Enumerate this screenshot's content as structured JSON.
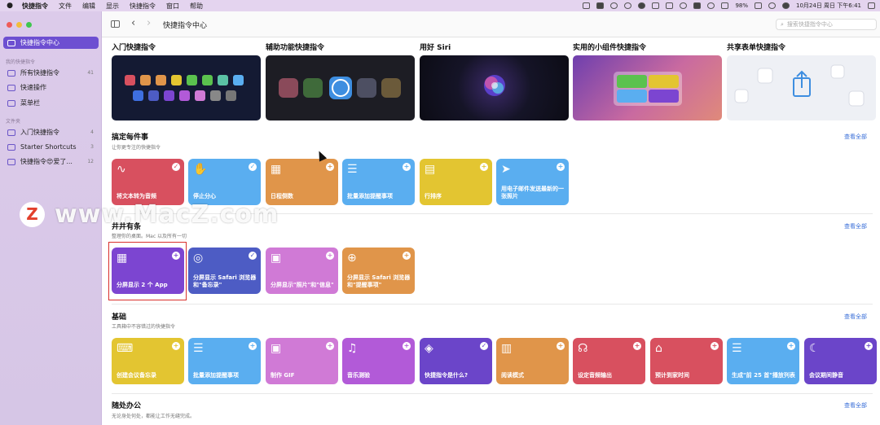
{
  "menubar": {
    "app_name": "快捷指令",
    "items": [
      "文件",
      "编辑",
      "显示",
      "快捷指令",
      "窗口",
      "帮助"
    ],
    "battery": "98%",
    "clock": "10月24日 周日 下午6:41"
  },
  "sidebar": {
    "gallery": "快捷指令中心",
    "library_header": "我的快捷指令",
    "library": [
      {
        "label": "所有快捷指令",
        "count": "41"
      },
      {
        "label": "快速操作",
        "count": ""
      },
      {
        "label": "菜单栏",
        "count": ""
      }
    ],
    "folders_header": "文件夹",
    "folders": [
      {
        "label": "入门快捷指令",
        "count": "4"
      },
      {
        "label": "Starter Shortcuts",
        "count": "3"
      },
      {
        "label": "快捷指令😍爱了...",
        "count": "12"
      }
    ]
  },
  "toolbar": {
    "title": "快捷指令中心",
    "search_placeholder": "搜索快捷指令中心"
  },
  "gallery": [
    {
      "title": "入门快捷指令"
    },
    {
      "title": "辅助功能快捷指令"
    },
    {
      "title": "用好 Siri"
    },
    {
      "title": "实用的小组件快捷指令"
    },
    {
      "title": "共享表单快捷指令"
    }
  ],
  "see_all": "查看全部",
  "sections": [
    {
      "title": "搞定每件事",
      "subtitle": "让你更专注的快捷指令",
      "cards": [
        {
          "label": "将文本转为音频",
          "color": "#d8505f",
          "icon": "waveform-icon",
          "glyph": "∿",
          "action": "✓"
        },
        {
          "label": "停止分心",
          "color": "#5aaef0",
          "icon": "hand-icon",
          "glyph": "✋",
          "action": "✓"
        },
        {
          "label": "日程倒数",
          "color": "#e0954a",
          "icon": "calendar-icon",
          "glyph": "▦",
          "action": "+"
        },
        {
          "label": "批量添加提醒事项",
          "color": "#5aaef0",
          "icon": "list-icon",
          "glyph": "☰",
          "action": "+"
        },
        {
          "label": "行排序",
          "color": "#e3c531",
          "icon": "document-icon",
          "glyph": "▤",
          "action": "+"
        },
        {
          "label": "用电子邮件发送最新的一张照片",
          "color": "#5aaef0",
          "icon": "paperplane-icon",
          "glyph": "➤",
          "action": "+"
        }
      ]
    },
    {
      "title": "井井有条",
      "subtitle": "整理你的桌面。Mac 以及所有一切",
      "cards": [
        {
          "label": "分屏显示 2 个 App",
          "color": "#7c45d1",
          "icon": "grid-icon",
          "glyph": "▦",
          "action": "+"
        },
        {
          "label": "分屏显示 Safari 浏览器和\"备忘录\"",
          "color": "#4d5cc4",
          "icon": "compass-icon",
          "glyph": "◎",
          "action": "✓"
        },
        {
          "label": "分屏显示\"照片\"和\"信息\"",
          "color": "#d07ad6",
          "icon": "photo-icon",
          "glyph": "▣",
          "action": "+"
        },
        {
          "label": "分屏显示 Safari 浏览器和\"提醒事项\"",
          "color": "#e0954a",
          "icon": "globe-icon",
          "glyph": "⊕",
          "action": "+"
        }
      ]
    },
    {
      "title": "基础",
      "subtitle": "工具箱中不容错过的快捷指令",
      "cards": [
        {
          "label": "创建会议备忘录",
          "color": "#e3c531",
          "icon": "keyboard-icon",
          "glyph": "⌨",
          "action": "+"
        },
        {
          "label": "批量添加提醒事项",
          "color": "#5aaef0",
          "icon": "list-icon",
          "glyph": "☰",
          "action": "+"
        },
        {
          "label": "制作 GIF",
          "color": "#d07ad6",
          "icon": "photo-stack-icon",
          "glyph": "▣",
          "action": "+"
        },
        {
          "label": "音乐测验",
          "color": "#b25ad8",
          "icon": "music-icon",
          "glyph": "♫",
          "action": "+"
        },
        {
          "label": "快捷指令是什么?",
          "color": "#6b45c9",
          "icon": "layers-icon",
          "glyph": "◈",
          "action": "✓"
        },
        {
          "label": "阅读模式",
          "color": "#e0954a",
          "icon": "book-icon",
          "glyph": "▥",
          "action": "+"
        },
        {
          "label": "设定音频输出",
          "color": "#d8505f",
          "icon": "headphones-icon",
          "glyph": "☊",
          "action": "+"
        },
        {
          "label": "预计到家时间",
          "color": "#d8505f",
          "icon": "house-icon",
          "glyph": "⌂",
          "action": "+"
        },
        {
          "label": "生成\"前 25 首\"播放列表",
          "color": "#5aaef0",
          "icon": "list-icon",
          "glyph": "☰",
          "action": "+"
        },
        {
          "label": "会议期间静音",
          "color": "#6b45c9",
          "icon": "moon-icon",
          "glyph": "☾",
          "action": "+"
        }
      ]
    },
    {
      "title": "随处办公",
      "subtitle": "无论身处何处，都能让工作无缝完成。",
      "cards": []
    }
  ],
  "watermark": {
    "logo": "Z",
    "text": "www.MacZ.com"
  }
}
